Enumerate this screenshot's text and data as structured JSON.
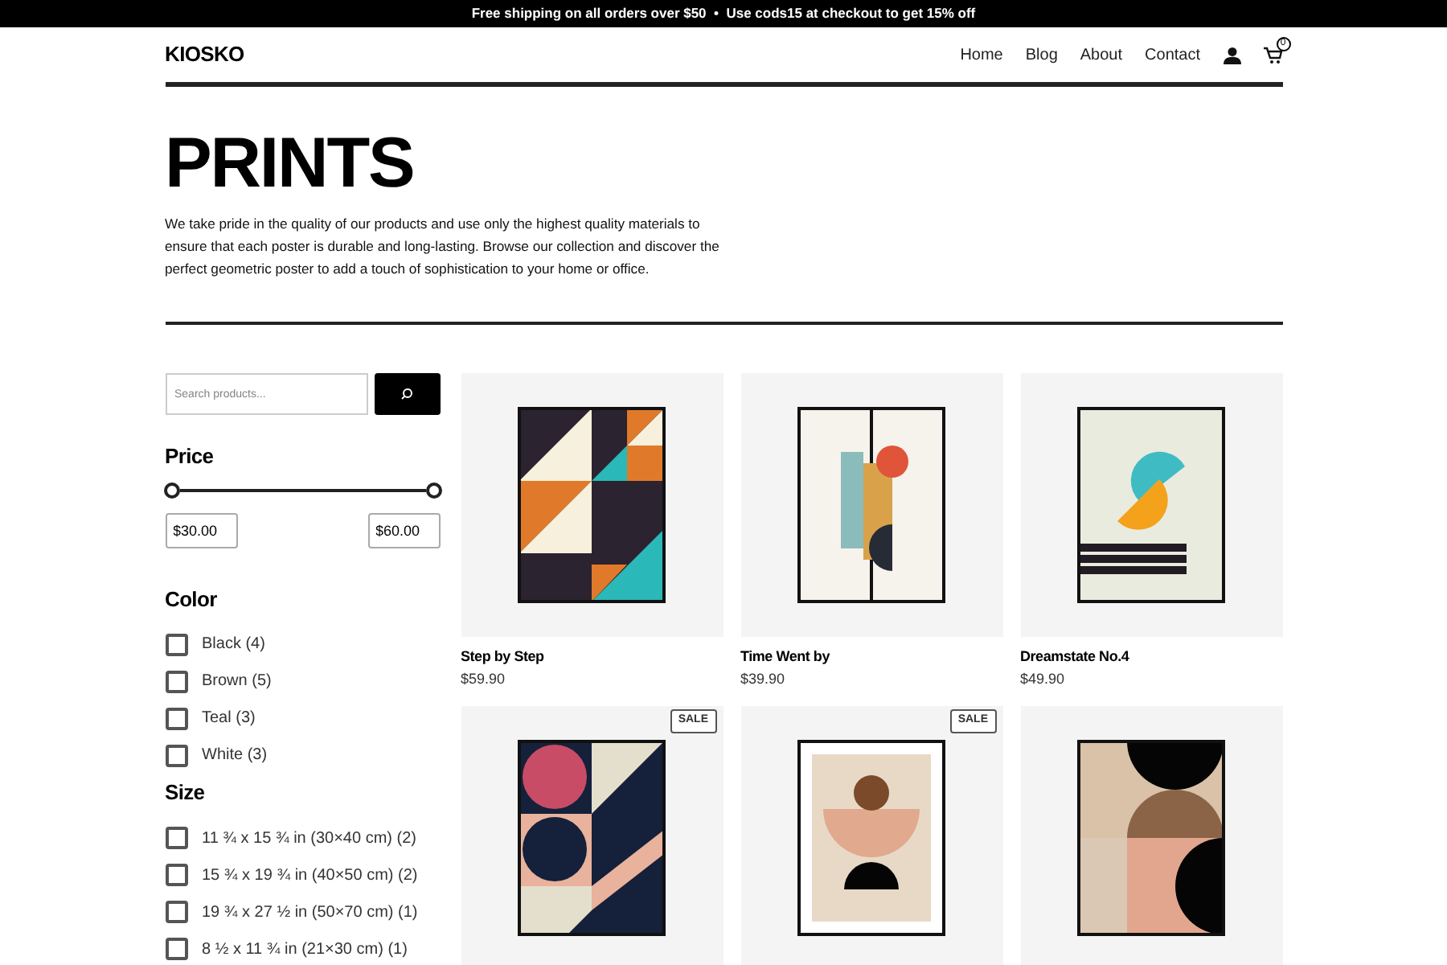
{
  "announcement": "Free shipping on all orders over $50  •  Use cods15 at checkout to get 15% off",
  "header": {
    "logo": "KIOSKO",
    "nav": [
      "Home",
      "Blog",
      "About",
      "Contact"
    ],
    "cart_count": "0"
  },
  "hero": {
    "title": "PRINTS",
    "text": "We take pride in the quality of our products and use only the highest quality materials to ensure that each poster is durable and long-lasting. Browse our collection and discover the perfect geometric poster to add a touch of sophistication to your home or office."
  },
  "search": {
    "placeholder": "Search products..."
  },
  "price": {
    "title": "Price",
    "thumbs": [
      {
        "level": 0
      },
      {
        "level": 1
      }
    ],
    "min": "$30.00",
    "max": "$60.00"
  },
  "color_filter": {
    "title": "Color",
    "options": [
      {
        "label": "Black (4)",
        "checked": false
      },
      {
        "label": "Brown (5)",
        "checked": false
      },
      {
        "label": "Teal (3)",
        "checked": false
      },
      {
        "label": "White (3)",
        "checked": false
      }
    ]
  },
  "size_filter": {
    "title": "Size",
    "options": [
      {
        "label": "11 ¾ x 15 ¾ in (30×40 cm) (2)",
        "checked": false
      },
      {
        "label": "15 ¾ x 19 ¾ in (40×50 cm) (2)",
        "checked": false
      },
      {
        "label": "19 ¾ x 27 ½ in (50×70 cm) (1)",
        "checked": false
      },
      {
        "label": "8 ½ x 11 ¾ in (21×30 cm) (1)",
        "checked": false
      }
    ]
  },
  "products": [
    {
      "name": "Step by Step",
      "price": "$59.90"
    },
    {
      "name": "Time Went by",
      "price": "$39.90"
    },
    {
      "name": "Dreamstate No.4",
      "price": "$49.90"
    },
    {
      "on_sale": true,
      "badge": "SALE"
    },
    {
      "on_sale": true,
      "badge": "SALE"
    },
    {
      "on_sale": false
    }
  ]
}
